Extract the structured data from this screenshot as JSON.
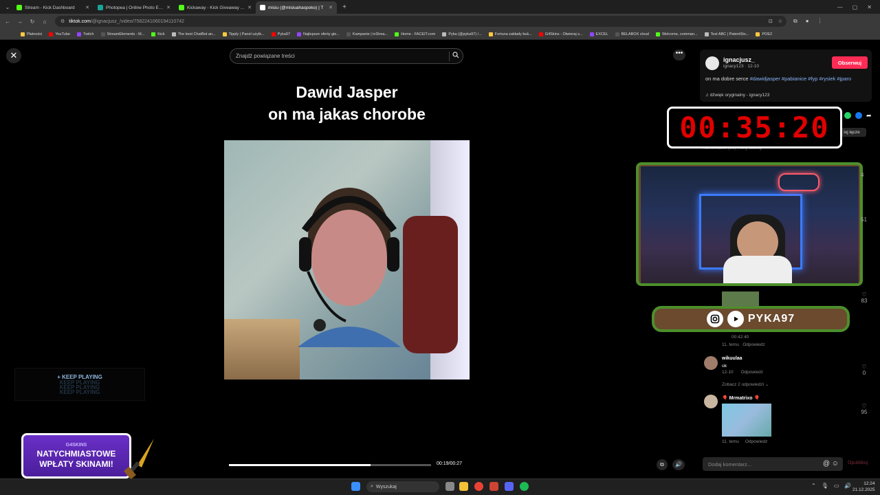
{
  "browser": {
    "tabs": [
      {
        "title": "Stream - Kick Dashboard",
        "icon": "kick-icon",
        "color": "#53fc18"
      },
      {
        "title": "Photopea | Online Photo Editor",
        "icon": "photopea-icon",
        "color": "#18a497"
      },
      {
        "title": "Kickaway - Kick Giveaway Tool",
        "icon": "kick-icon",
        "color": "#53fc18"
      },
      {
        "title": "misiu (@misiuahaspoko) | T",
        "icon": "tiktok-icon",
        "color": "#ffffff",
        "active": true
      }
    ],
    "new_tab": "+",
    "address": {
      "host": "tiktok.com",
      "path": "/@ignacjusz_/video/7582241060194110742"
    },
    "bookmarks": [
      "Płatności",
      "YouTube",
      "Twitch",
      "StreamElements - M...",
      "Kick",
      "The best ChatBot an...",
      "Tipply | Panel użytk...",
      "Pyka97",
      "Najlepsze oferty gie...",
      "Kampanie | inStrea...",
      "Home - FACEIT.com",
      "Pyka (@pyka97) /...",
      "Fortuna zakłady buk...",
      "G4Skins - Otwieraj s...",
      "EXCEL",
      "BELABOX cloud",
      "Welcome, comman...",
      "Test ABC | PatentSto...",
      "POE2"
    ]
  },
  "video": {
    "search_placeholder": "Znajdź powiązane treści",
    "title_line1": "Dawid Jasper",
    "title_line2": "on ma jakas chorobe",
    "progress": 0.7,
    "time": "00:19/00:27"
  },
  "author": {
    "name": "ignacjusz_",
    "sub": "ignacy123 · 12-10",
    "follow_label": "Obserwuj",
    "desc_text": "on ma dobre serce ",
    "hashtags": "#dawidjasper #pabianice #fyp #rysiek #jparo",
    "sound": "♫  dźwięk oryginalny - ignacy123"
  },
  "overlay": {
    "timer": "00:35:20",
    "embed_label": "iuj łącze",
    "tabs_text": "Komentarze (56)                         Filmy twórcy",
    "channel_name": "PYKA97",
    "keep_playing": "+ KEEP PLAYING",
    "keep_echo": "KEEP PLAYING",
    "promo_brand": "G4SKINS",
    "promo_line1": "NATYCHMIASTOWE",
    "promo_line2": "WPŁATY SKINAMI!"
  },
  "comments": {
    "c1": {
      "time": "00:42:40",
      "meta": "11. temu",
      "reply": "Odpowiedz",
      "likes": "83"
    },
    "c2": {
      "name": "wikuulaa",
      "text": "ok",
      "date": "12-10",
      "reply": "Odpowiedz",
      "likes": "0",
      "more": "Zobacz 2 odpowiedzi ⌄"
    },
    "c3": {
      "name": "Mrmatrixo",
      "meta": "11. temu",
      "reply": "Odpowiedz",
      "likes": "95"
    },
    "side_likes": [
      "4",
      "51"
    ],
    "input_placeholder": "Dodaj komentarz...",
    "post_label": "Opublikuj"
  },
  "taskbar": {
    "search_label": "Wyszukaj",
    "time": "12:24",
    "date": "21.12.2025"
  }
}
